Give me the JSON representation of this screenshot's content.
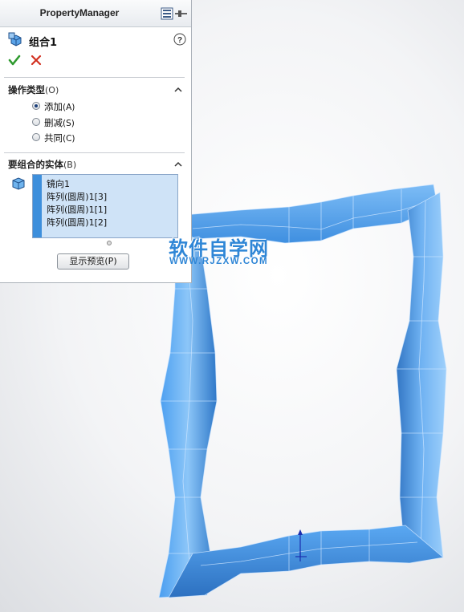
{
  "panel": {
    "title": "PropertyManager",
    "feature_name": "组合1",
    "ok_icon": "checkmark-icon",
    "cancel_icon": "close-icon",
    "help_icon": "question-icon"
  },
  "operation_type": {
    "title": "操作类型",
    "hotkey": "(O)",
    "options": [
      {
        "label": "添加",
        "hotkey": "(A)",
        "checked": true
      },
      {
        "label": "删减",
        "hotkey": "(S)",
        "checked": false
      },
      {
        "label": "共同",
        "hotkey": "(C)",
        "checked": false
      }
    ]
  },
  "bodies": {
    "title": "要组合的实体",
    "hotkey": "(B)",
    "items": [
      "镜向1",
      "阵列(圆周)1[3]",
      "阵列(圆周)1[1]",
      "阵列(圆周)1[2]"
    ]
  },
  "preview_button": "显示预览(P)",
  "watermark": {
    "main": "软件自学网",
    "sub": "WWW.RJZXW.COM"
  },
  "colors": {
    "model_blue": "#4aa0ee",
    "selection_bar": "#3d8fdc",
    "selection_bg": "#cfe3f7",
    "ok_green": "#2e9a2e",
    "cancel_red": "#d23020",
    "watermark_blue": "#2f86d6"
  }
}
